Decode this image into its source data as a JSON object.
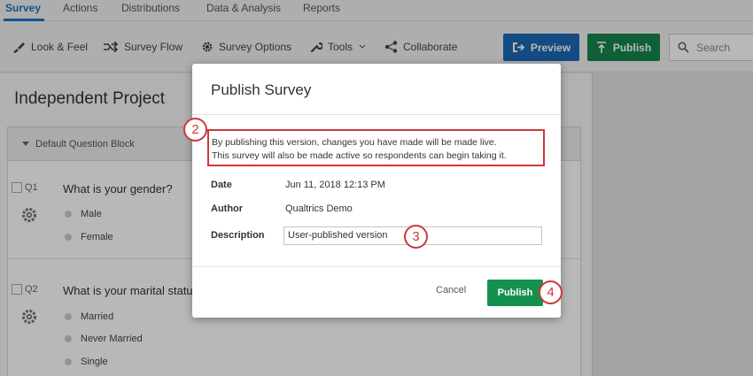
{
  "nav": {
    "tabs": [
      "Survey",
      "Actions",
      "Distributions",
      "Data & Analysis",
      "Reports"
    ]
  },
  "toolbar": {
    "look_feel": "Look & Feel",
    "survey_flow": "Survey Flow",
    "survey_options": "Survey Options",
    "tools": "Tools",
    "collaborate": "Collaborate",
    "preview": "Preview",
    "publish": "Publish",
    "search_placeholder": "Search"
  },
  "editor": {
    "project_title": "Independent Project",
    "block_label": "Default Question Block",
    "questions": [
      {
        "num": "Q1",
        "text": "What is your gender?",
        "options": [
          "Male",
          "Female"
        ]
      },
      {
        "num": "Q2",
        "text": "What is your marital statu",
        "options": [
          "Married",
          "Never Married",
          "Single"
        ]
      }
    ]
  },
  "modal": {
    "title": "Publish Survey",
    "notice_line1": "By publishing this version, changes you have made will be made live.",
    "notice_line2": "This survey will also be made active so respondents can begin taking it.",
    "date_label": "Date",
    "date_value": "Jun 11, 2018 12:13 PM",
    "author_label": "Author",
    "author_value": "Qualtrics Demo",
    "description_label": "Description",
    "description_value": "User-published version",
    "cancel": "Cancel",
    "publish": "Publish"
  },
  "callouts": [
    "2",
    "3",
    "4"
  ],
  "colors": {
    "accent_blue": "#1a73c7",
    "publish_green": "#16864b",
    "callout_red": "#d0363b"
  }
}
